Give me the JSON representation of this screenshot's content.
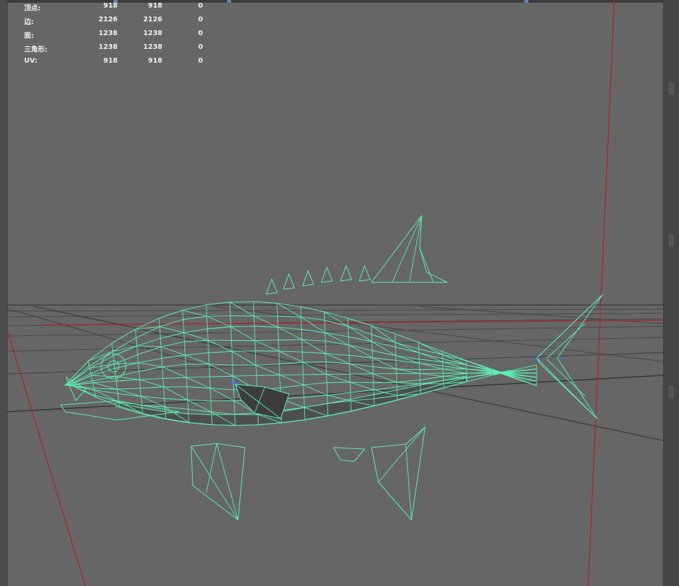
{
  "app": {
    "panel": "maya-style 3d viewport",
    "wireframe_color": "#5cf0b4",
    "background_color": "#666666",
    "grid_color": "#3a3a3a",
    "axis_color": "#c02020"
  },
  "hud": {
    "rows": [
      {
        "label": "顶点:",
        "v1": "918",
        "v2": "918",
        "v3": "0"
      },
      {
        "label": "边:",
        "v1": "2126",
        "v2": "2126",
        "v3": "0"
      },
      {
        "label": "面:",
        "v1": "1238",
        "v2": "1238",
        "v3": "0"
      },
      {
        "label": "三角形:",
        "v1": "1238",
        "v2": "1238",
        "v3": "0"
      },
      {
        "label": "UV:",
        "v1": "918",
        "v2": "918",
        "v3": "0"
      }
    ]
  }
}
